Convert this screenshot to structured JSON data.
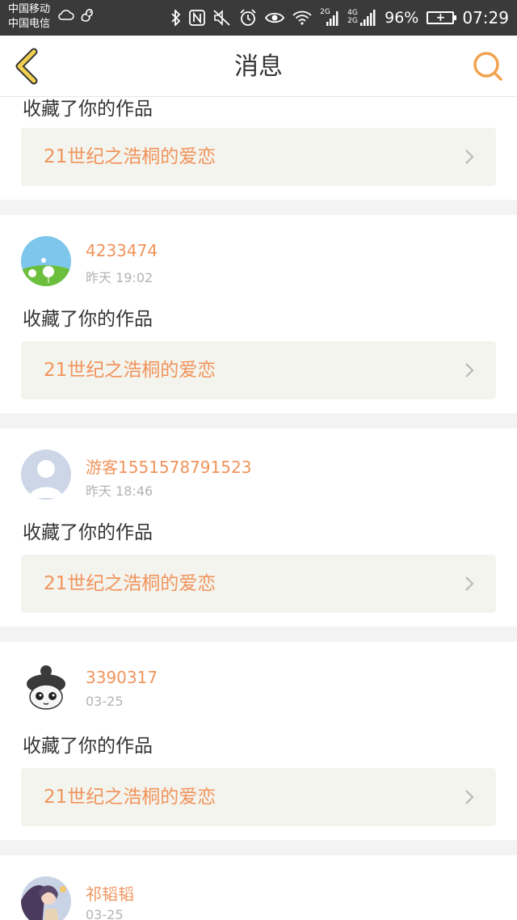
{
  "status_bar": {
    "carrier_1": "中国移动",
    "carrier_2": "中国电信",
    "battery_percent": "96%",
    "time": "07:29",
    "network_1": "2G",
    "network_2_top": "4G",
    "network_2_bottom": "2G",
    "icons": [
      "cloud-icon",
      "squirrel-icon",
      "bluetooth-icon",
      "nfc-icon",
      "mute-icon",
      "alarm-icon",
      "eye-icon",
      "wifi-icon",
      "signal-icon",
      "battery-icon"
    ]
  },
  "header": {
    "title": "消息",
    "back_icon": "chevron-left-icon",
    "search_icon": "search-icon",
    "accent_color": "#f2a24f"
  },
  "partial_top": {
    "action": "收藏了你的作品",
    "work_title": "21世纪之浩桐的爱恋"
  },
  "messages": [
    {
      "username": "4233474",
      "time": "昨天 19:02",
      "action": "收藏了你的作品",
      "work_title": "21世纪之浩桐的爱恋",
      "avatar": "dandelion-avatar"
    },
    {
      "username": "游客1551578791523",
      "time": "昨天 18:46",
      "action": "收藏了你的作品",
      "work_title": "21世纪之浩桐的爱恋",
      "avatar": "default-user-avatar"
    },
    {
      "username": "3390317",
      "time": "03-25",
      "action": "收藏了你的作品",
      "work_title": "21世纪之浩桐的爱恋",
      "avatar": "cartoon-character-avatar"
    },
    {
      "username": "祁韬韬",
      "time": "03-25",
      "avatar": "anime-avatar"
    }
  ],
  "colors": {
    "username": "#f0945c",
    "link_background": "#f4f4ee",
    "separator": "#f3f3f3",
    "status_bar": "#3a3a3a"
  }
}
